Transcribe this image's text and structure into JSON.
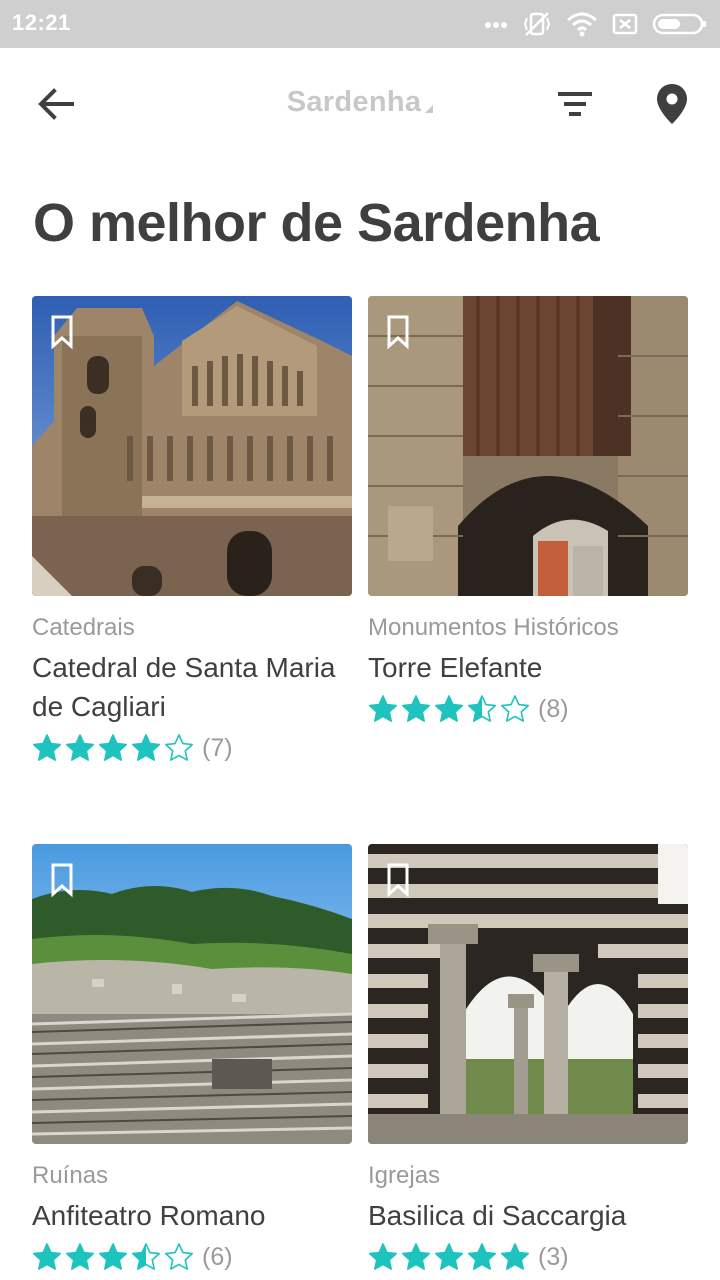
{
  "status_bar": {
    "time": "12:21"
  },
  "app_bar": {
    "title": "Sardenha"
  },
  "heading": "O melhor de Sardenha",
  "colors": {
    "star": "#1fc3bd",
    "title_inactive": "#c8c8c8",
    "status_bar_bg": "#cfcfcf"
  },
  "places": [
    {
      "category": "Catedrais",
      "name": "Catedral de Santa Maria de Cagliari",
      "rating": 4,
      "reviews": "(7)"
    },
    {
      "category": "Monumentos Históricos",
      "name": "Torre Elefante",
      "rating": 3.5,
      "reviews": "(8)"
    },
    {
      "category": "Ruínas",
      "name": "Anfiteatro Romano",
      "rating": 3.5,
      "reviews": "(6)"
    },
    {
      "category": "Igrejas",
      "name": "Basilica di Saccargia",
      "rating": 5,
      "reviews": "(3)"
    }
  ]
}
